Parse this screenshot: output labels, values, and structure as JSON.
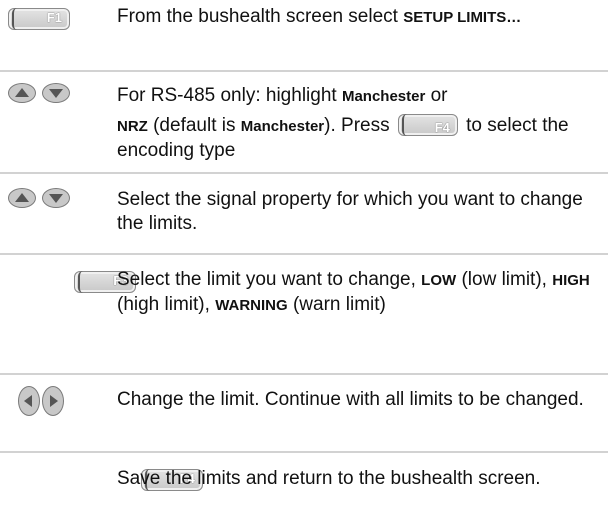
{
  "key_labels": {
    "f1": "F1",
    "f3": "F3",
    "f4": "F4"
  },
  "steps": [
    {
      "key": "F1",
      "t1": "From the bushealth screen select ",
      "b1": "SETUP LIMITS…"
    },
    {
      "key": "up-down",
      "t1": "For RS-485 only: highlight  ",
      "b1": "Manchester",
      "t2": " or ",
      "b2": "NRZ",
      "t3": " (default is ",
      "b3": "Manchester",
      "t4": "). Press ",
      "t5": " to select the encoding type"
    },
    {
      "key": "up-down",
      "t1": "Select the signal property for which you want to change the limits."
    },
    {
      "key": "F3",
      "t1": "Select the limit you want to change, ",
      "b1": "LOW",
      "t2": " (low limit), ",
      "b2": "HIGH",
      "t3": " (high limit), ",
      "b3": "WARNING",
      "t4": " (warn limit)"
    },
    {
      "key": "left-right",
      "t1": "Change the limit. Continue with all limits to be changed."
    },
    {
      "key": "F4",
      "t1": "Save the limits and return to the bushealth screen."
    }
  ]
}
